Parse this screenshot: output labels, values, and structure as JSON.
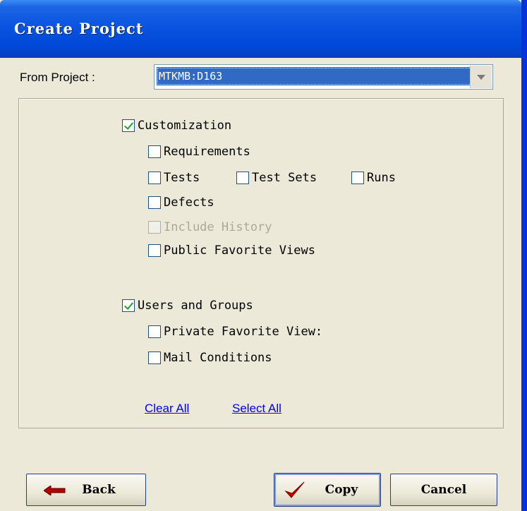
{
  "dialog": {
    "title": "Create Project"
  },
  "from_project": {
    "label": "From Project :",
    "value": "MTKMB:D163"
  },
  "options": {
    "customization": {
      "label": "Customization",
      "checked": true
    },
    "requirements": {
      "label": "Requirements",
      "checked": false
    },
    "tests": {
      "label": "Tests",
      "checked": false
    },
    "test_sets": {
      "label": "Test Sets",
      "checked": false
    },
    "runs": {
      "label": "Runs",
      "checked": false
    },
    "defects": {
      "label": "Defects",
      "checked": false
    },
    "include_history": {
      "label": "Include History",
      "checked": false,
      "disabled": true
    },
    "public_favorite_views": {
      "label": "Public Favorite Views",
      "checked": false
    },
    "users_and_groups": {
      "label": "Users and Groups",
      "checked": true
    },
    "private_favorite_view": {
      "label": "Private Favorite View:",
      "checked": false
    },
    "mail_conditions": {
      "label": "Mail Conditions",
      "checked": false
    }
  },
  "links": {
    "clear_all": "Clear All",
    "select_all": "Select All"
  },
  "buttons": {
    "back": "Back",
    "copy": "Copy",
    "cancel": "Cancel"
  },
  "icons": {
    "back": "left-arrow-icon",
    "copy": "checkmark-icon",
    "dropdown": "chevron-down-icon"
  },
  "colors": {
    "titlebar": "#0a54e0",
    "selection": "#316ac5",
    "link": "#0000ee",
    "check": "#21a121"
  }
}
